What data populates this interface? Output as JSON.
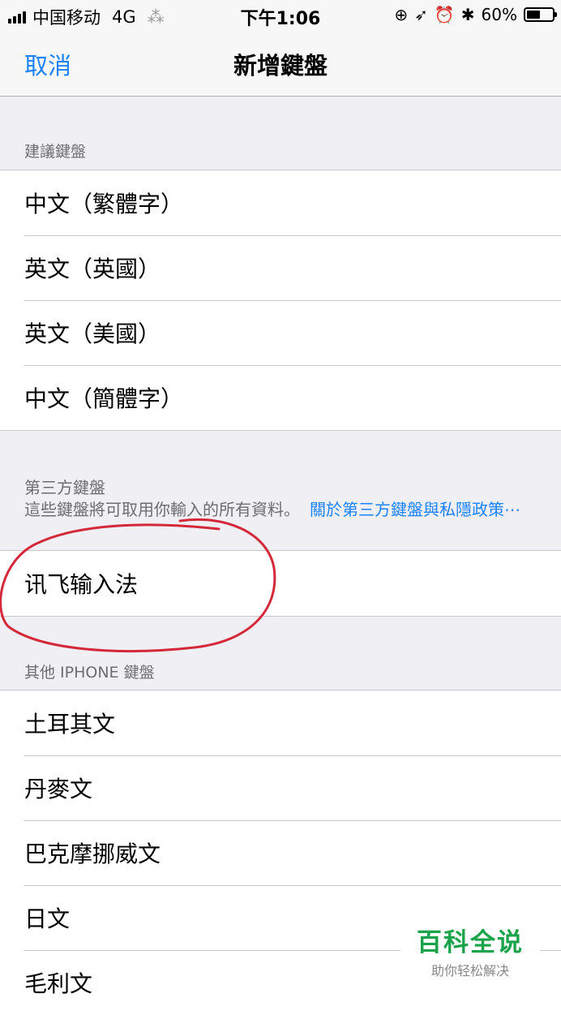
{
  "status_bar": {
    "carrier": "中国移动",
    "network": "4G",
    "time": "下午1:06",
    "battery": "60%",
    "battery_level": 0.6
  },
  "nav": {
    "cancel": "取消",
    "title": "新增鍵盤"
  },
  "suggested": {
    "header": "建議鍵盤",
    "items": [
      "中文（繁體字）",
      "英文（英國）",
      "英文（美國）",
      "中文（簡體字）"
    ]
  },
  "third_party": {
    "header": "第三方鍵盤",
    "footer_text": "這些鍵盤將可取用你輸入的所有資料。",
    "footer_link": "關於第三方鍵盤與私隱政策⋯",
    "items": [
      "讯飞输入法"
    ]
  },
  "other": {
    "header": "其他 IPHONE 鍵盤",
    "items": [
      "土耳其文",
      "丹麥文",
      "巴克摩挪威文",
      "日文",
      "毛利文"
    ]
  },
  "watermark": {
    "title": "百科全说",
    "subtitle": "助你轻松解决"
  },
  "colors": {
    "accent": "#1a82fb",
    "annotation": "#d4293a",
    "watermark": "#1aa34a"
  }
}
